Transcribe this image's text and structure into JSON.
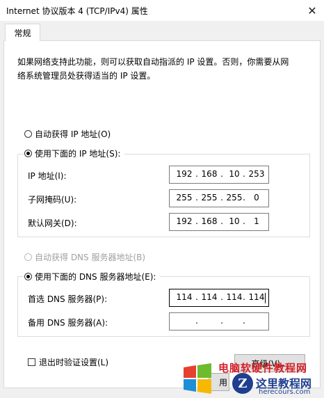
{
  "window": {
    "title": "Internet 协议版本 4 (TCP/IPv4) 属性",
    "close_glyph": "✕"
  },
  "tabs": [
    {
      "label": "常规"
    }
  ],
  "description": {
    "line1": "如果网络支持此功能，则可以获取自动指派的 IP 设置。否则，你需要从网",
    "line2": "络系统管理员处获得适当的 IP 设置。"
  },
  "ip_mode": {
    "auto_label": "自动获得 IP 地址(O)",
    "manual_label": "使用下面的 IP 地址(S):",
    "selected": "manual"
  },
  "ip_fields": [
    {
      "label": "IP 地址(I):",
      "octets": [
        "192",
        "168",
        "10",
        "253"
      ]
    },
    {
      "label": "子网掩码(U):",
      "octets": [
        "255",
        "255",
        "255",
        "0"
      ]
    },
    {
      "label": "默认网关(D):",
      "octets": [
        "192",
        "168",
        "10",
        "1"
      ]
    }
  ],
  "dns_mode": {
    "auto_label": "自动获得 DNS 服务器地址(B)",
    "manual_label": "使用下面的 DNS 服务器地址(E):",
    "selected": "manual",
    "auto_disabled": true
  },
  "dns_fields": [
    {
      "label": "首选 DNS 服务器(P):",
      "octets": [
        "114",
        "114",
        "114",
        "114"
      ]
    },
    {
      "label": "备用 DNS 服务器(A):",
      "octets": [
        "",
        "",
        "",
        ""
      ]
    }
  ],
  "validate_on_exit": {
    "label": "退出时验证设置(L)",
    "checked": false
  },
  "advanced_button": {
    "label": "高级(V)..."
  },
  "partial_button": {
    "label": "用"
  },
  "watermark": {
    "red_text": "电脑软硬件教程网",
    "logo_letter": "Z",
    "cn_text": "这里教程网",
    "url": "herecours.com"
  },
  "colors": {
    "dialog_bg": "#f0f0f0",
    "panel_bg": "#ffffff",
    "button_bg": "#e1e1e1",
    "disabled_text": "#a0a0a0",
    "watermark_red": "#d61f26",
    "watermark_blue": "#1f3f8f"
  }
}
